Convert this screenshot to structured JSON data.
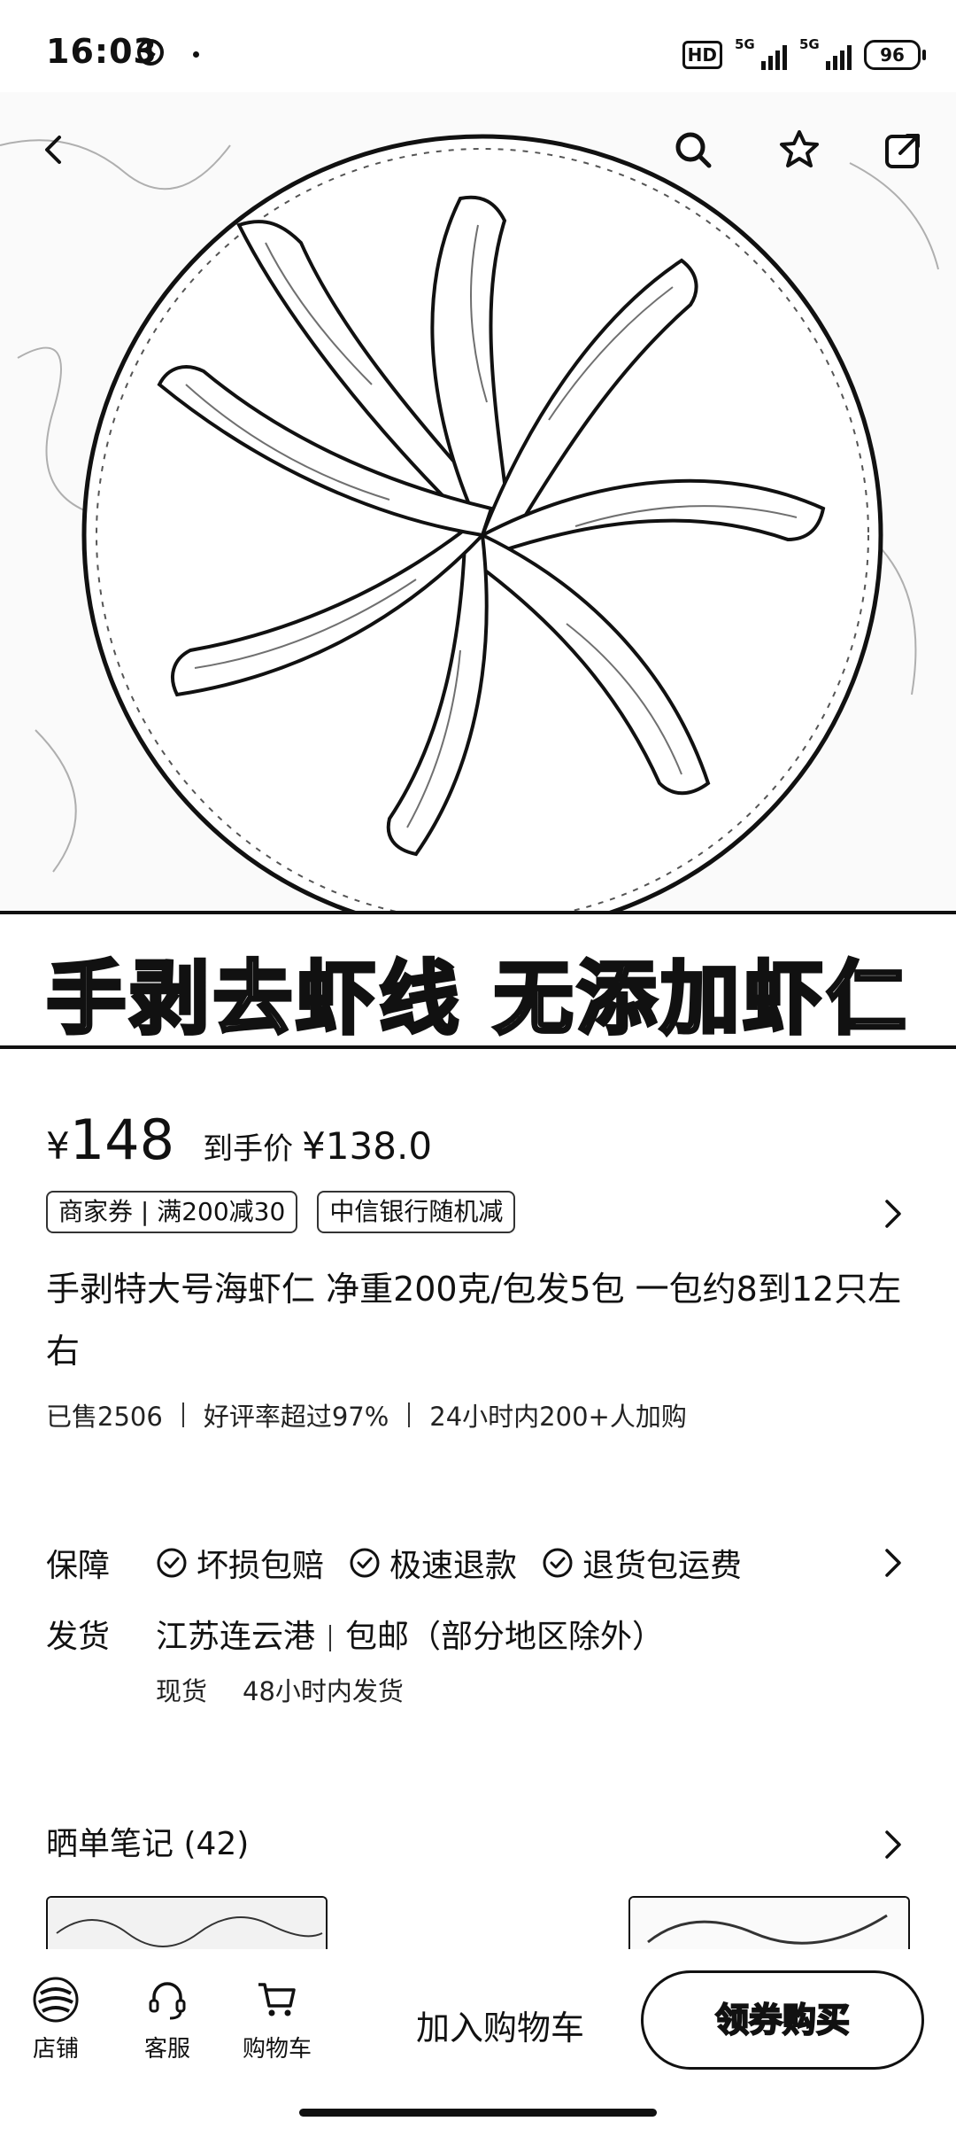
{
  "status_bar": {
    "time": "16:03",
    "hd": "HD",
    "network1": "5G",
    "network2": "5G",
    "battery": "96"
  },
  "hero": {
    "banner_text": "手剥去虾线 无添加虾仁",
    "back_icon": "chevron-left-icon",
    "search_icon": "search-icon",
    "favorite_icon": "star-icon",
    "share_icon": "share-icon"
  },
  "price": {
    "main_symbol": "¥",
    "main_value": "148",
    "after_label": "到手价",
    "after_value": "¥138.0"
  },
  "coupons": [
    {
      "label": "商家券 | 满200减30"
    },
    {
      "label": "中信银行随机减"
    }
  ],
  "product": {
    "title": "手剥特大号海虾仁 净重200克/包发5包 一包约8到12只左右"
  },
  "stats": {
    "sold": "已售2506",
    "rating": "好评率超过97%",
    "recent": "24小时内200+人加购"
  },
  "guarantee": {
    "label": "保障",
    "items": [
      "坏损包赔",
      "极速退款",
      "退货包运费"
    ]
  },
  "shipping": {
    "label": "发货",
    "origin": "江苏连云港",
    "policy": "包邮（部分地区除外）",
    "stock": "现货",
    "dispatch": "48小时内发货"
  },
  "notes": {
    "title": "晒单笔记 (42)"
  },
  "bottom_bar": {
    "store_label": "店铺",
    "service_label": "客服",
    "cart_label": "购物车",
    "add_cart_label": "加入购物车",
    "buy_label": "领券购买"
  }
}
